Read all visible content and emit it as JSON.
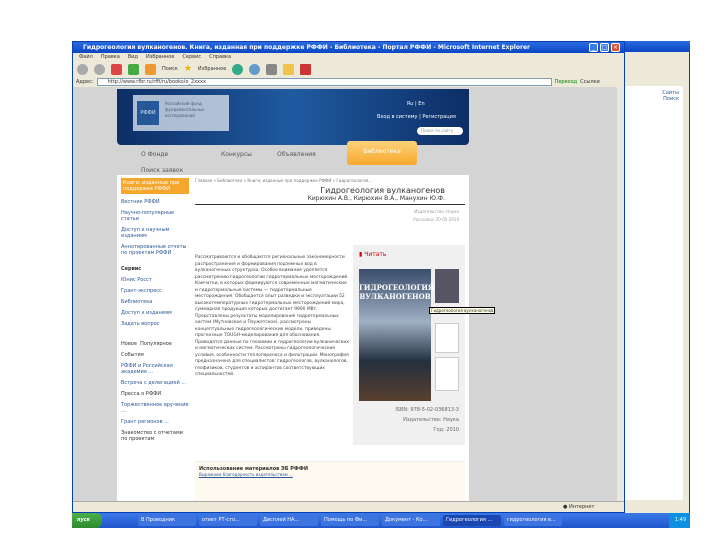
{
  "window": {
    "title": "Гидрогеология вулканогенов. Книга, изданная при поддержке РФФИ - Библиотека - Портал РФФИ - Microsoft Internet Explorer"
  },
  "menu": [
    "Файл",
    "Правка",
    "Вид",
    "Избранное",
    "Сервис",
    "Справка"
  ],
  "toolbar": {
    "search": "Поиск",
    "favorites": "Избранное"
  },
  "address": {
    "label": "Адрес:",
    "url": "http://www.rfbr.ru/rffi/ru/books/o_2xxxx",
    "go": "Переход",
    "links": "Ссылки"
  },
  "header": {
    "logo": "РФФИ",
    "logo_text": "Российский фонд фундаментальных исследований",
    "lang": "Ru | En",
    "login": "Вход в систему | Регистрация",
    "search_placeholder": "Поиск по сайту"
  },
  "nav": {
    "items": [
      "О Фонде",
      "Конкурсы",
      "Объявления",
      "Библиотека"
    ],
    "active": "Библиотека",
    "second": "Поиск заявок"
  },
  "sidebar": {
    "items": [
      "Книги, изданные при поддержке РФФИ",
      "Вестник РФФИ",
      "Научно-популярные статьи",
      "Доступ к научным изданиям",
      "Аннотированные отчеты по проектам РФФИ"
    ],
    "services_title": "Сервис",
    "services": [
      "Юнис Росст",
      "Грант-экспресс",
      "Библиотека",
      "Доступ к изданиям",
      "Задать вопрос"
    ],
    "news_tabs": [
      "Новое",
      "Популярное"
    ],
    "news": [
      {
        "cat": "События",
        "text": "РФФИ и Российская академия ..."
      },
      {
        "cat": "",
        "text": "Встреча с делегацией ..."
      },
      {
        "cat": "Пресса о РФФИ",
        "text": "Торжественное вручение ..."
      },
      {
        "cat": "",
        "text": "Грант регионов ..."
      },
      {
        "cat": "Знакомство с отчетами по проектам",
        "text": ""
      }
    ]
  },
  "main": {
    "breadcrumb": "Главная » Библиотека » Книги, изданные при поддержке РФФИ » Гидрогеология...",
    "title": "Гидрогеология вулканогенов",
    "authors": "Кирюхин А.В., Кирюхин В.А., Манухин Ю.Ф.",
    "meta": [
      "Издательство: Наука",
      "Рассылка: 20-05-2010"
    ],
    "abstract": "Рассматриваются и обобщаются региональные закономерности распространения и формирования подземных вод в вулканогенных структурах. Особое внимание уделяется рассмотрению гидрогеологии гидротермальных месторождений Камчатки, в которых формируются современные магматические и гидротермальные системы — гидротермальные месторождения. Обобщается опыт разведки и эксплуатации 52 высокотемпературных гидротермальных месторождений мира, суммарная продукция которых достигает 9900 МВт. Представлены результаты моделирования гидротермальных систем (Мутновское и Паужетское), рассмотрены концептуальные гидрогеологические модели, приведены прогнозные TOUGH-моделирования для обоснования. Приводятся данные по геохимии и гидрогеологии вулканических и магматических систем. Рассмотрены гидрогеологические условия, особенности теплопереноса и фильтрации. Монография предназначена для специалистов: гидрогеологов, вулканологов, геофизиков, студентов и аспирантов соответствующих специальностей.",
    "read": "Читать",
    "cover_title": "ГИДРОГЕОЛОГИЯ ВУЛКАНОГЕНОВ",
    "thumb_tooltip": "Гидрогеология вулканогенов",
    "isbn": "ISBN: 978-5-02-036813-3",
    "publisher": "Издательство: Наука",
    "year": "Год: 2010",
    "use_title": "Использование материалов ЭБ РФФИ",
    "use_link": "Выражаем благодарность издательствам ..."
  },
  "status": {
    "zone": "Интернет"
  },
  "taskbar": {
    "start": "пуск",
    "tasks": [
      "В Проводник",
      "ответ РТ-сто...",
      "Дисплей НА...",
      "Помощь по Фи...",
      "Документ - Ко...",
      "Гидрогеология ...",
      "гидрогеология в..."
    ],
    "time": "1:49"
  },
  "window2": {
    "links": [
      "Сайты",
      "Поиск"
    ]
  }
}
